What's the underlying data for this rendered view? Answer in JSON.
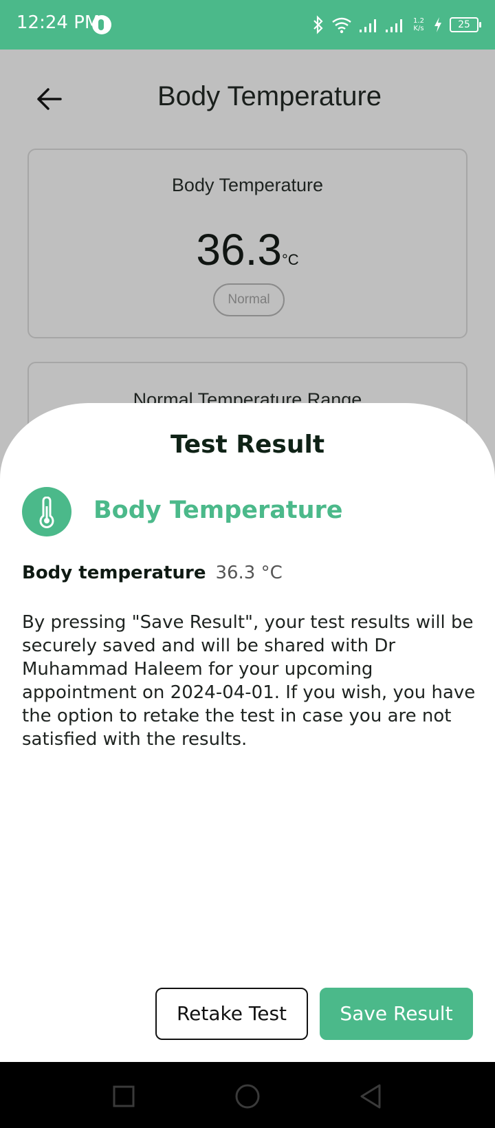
{
  "status_bar": {
    "time": "12:24 PM",
    "net_speed_top": "1.2",
    "net_speed_bottom": "K/s",
    "battery": "25",
    "icons": [
      "app-icon",
      "bluetooth-icon",
      "wifi-icon",
      "signal-icon",
      "signal-icon",
      "charging-icon",
      "battery-icon"
    ]
  },
  "header": {
    "title": "Body Temperature",
    "back_icon": "arrow-left-icon"
  },
  "reading_card": {
    "label": "Body Temperature",
    "value": "36.3",
    "unit": "°C",
    "status": "Normal"
  },
  "range_card": {
    "label": "Normal Temperature Range"
  },
  "sheet": {
    "title": "Test Result",
    "test_icon": "thermometer-icon",
    "test_name": "Body Temperature",
    "result_label": "Body temperature",
    "result_value": "36.3 °C",
    "disclaimer": "By pressing \"Save Result\", your test results will be securely saved and will be shared with Dr Muhammad Haleem for your upcoming appointment on 2024-04-01. If you wish, you have the option to retake the test in case you are not satisfied with the results.",
    "retake_label": "Retake Test",
    "save_label": "Save Result"
  },
  "nav_bar": {
    "icons": [
      "recent-apps-icon",
      "home-icon",
      "back-icon"
    ]
  },
  "colors": {
    "accent": "#4bb98a",
    "scrim": "#bfbfbf"
  }
}
